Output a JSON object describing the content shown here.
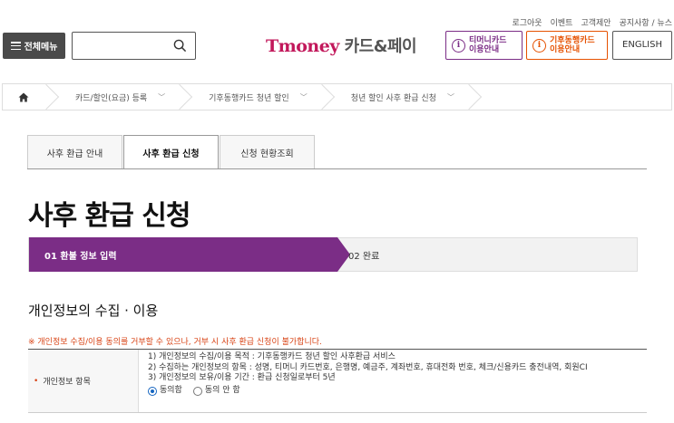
{
  "util_links": [
    "로그아웃",
    "이벤트",
    "고객제안",
    "공지사항 / 뉴스"
  ],
  "header": {
    "menu_label": "전체메뉴",
    "search_placeholder": "",
    "logo_brand": "Tmoney",
    "logo_rest": " 카드&페이",
    "tmoney_guide": [
      "티머니카드",
      "이용안내"
    ],
    "climate_guide": [
      "기후동행카드",
      "이용안내"
    ],
    "english_label": "ENGLISH",
    "info_glyph": "i"
  },
  "breadcrumb": {
    "home_icon": "home-icon",
    "items": [
      "카드/할인(요금) 등록",
      "기후동행카드 청년 할인",
      "청년 할인 사후 환급 신청"
    ],
    "chevron": "﹀"
  },
  "tabs": [
    {
      "label": "사후 환급 안내",
      "active": false
    },
    {
      "label": "사후 환급 신청",
      "active": true
    },
    {
      "label": "신청 현황조회",
      "active": false
    }
  ],
  "page_title": "사후 환급 신청",
  "steps": {
    "step1": "01 환불 정보 입력",
    "step2": "02 완료",
    "active_color": "#7b2d86"
  },
  "section_title": "개인정보의 수집 · 이용",
  "notice": "※ 개인정보 수집/이용 동의를 거부할 수 있으나, 거부 시 사후 환급 신청이 불가합니다.",
  "privacy": {
    "label_bullet": "•",
    "label": "개인정보 항목",
    "lines": [
      "1) 개인정보의 수집/이용 목적 : 기후동행카드 청년 할인 사후환급 서비스",
      "2) 수집하는 개인정보의 항목 : 성명, 티머니 카드번호, 은행명, 예금주, 계좌번호, 휴대전화 번호, 체크/신용카드 충전내역, 회원CI",
      "3) 개인정보의 보유/이용 기간 : 환급 신청일로부터 5년"
    ],
    "agree": "동의함",
    "disagree": "동의 안 함",
    "selected": "agree"
  },
  "colors": {
    "brand": "#c2185b",
    "purple": "#7b2d86",
    "orange": "#e65100",
    "notice": "#d84315"
  }
}
